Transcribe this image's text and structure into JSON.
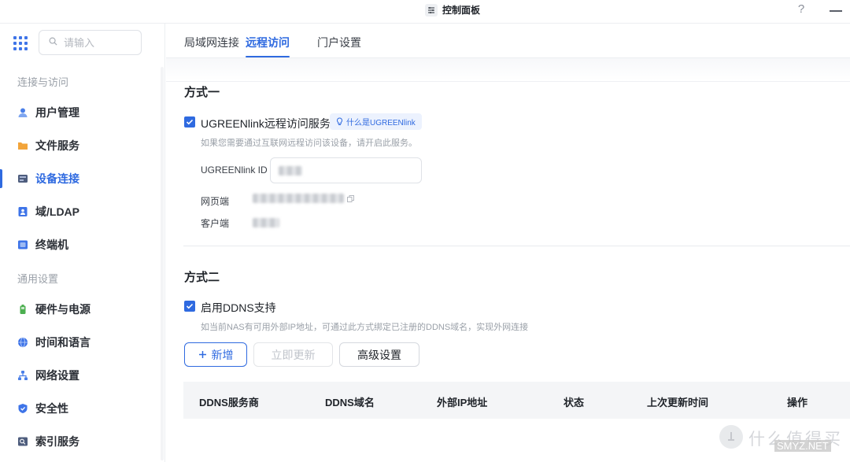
{
  "window": {
    "title": "控制面板",
    "help": "?",
    "app_icon": "sliders-icon"
  },
  "sidebar": {
    "search_placeholder": "请输入",
    "groups": [
      {
        "label": "连接与访问"
      },
      {
        "label": "通用设置"
      }
    ],
    "items": [
      {
        "label": "用户管理",
        "icon": "user-icon",
        "color": "#4a7fe8"
      },
      {
        "label": "文件服务",
        "icon": "folder-icon",
        "color": "#f2a43a"
      },
      {
        "label": "设备连接",
        "icon": "device-connect-icon",
        "color": "#5a6b8f",
        "active": true
      },
      {
        "label": "域/LDAP",
        "icon": "ldap-icon",
        "color": "#3e74e8"
      },
      {
        "label": "终端机",
        "icon": "terminal-icon",
        "color": "#3e74e8"
      },
      {
        "label": "硬件与电源",
        "icon": "battery-icon",
        "color": "#4caf50"
      },
      {
        "label": "时间和语言",
        "icon": "globe-icon",
        "color": "#3e74e8"
      },
      {
        "label": "网络设置",
        "icon": "network-icon",
        "color": "#4a7fe8"
      },
      {
        "label": "安全性",
        "icon": "shield-icon",
        "color": "#3e74e8"
      },
      {
        "label": "索引服务",
        "icon": "index-icon",
        "color": "#5a6b8f"
      }
    ]
  },
  "tabs": [
    {
      "label": "局域网连接"
    },
    {
      "label": "远程访问",
      "active": true
    },
    {
      "label": "门户设置"
    }
  ],
  "method1": {
    "title": "方式一",
    "checkbox_label": "UGREENlink远程访问服务",
    "checked": true,
    "help_link": "什么是UGREENlink",
    "hint": "如果您需要通过互联网远程访问该设备，请开启此服务。",
    "id_label": "UGREENlink ID",
    "web_label": "网页端",
    "client_label": "客户端"
  },
  "method2": {
    "title": "方式二",
    "checkbox_label": "启用DDNS支持",
    "checked": true,
    "hint": "如当前NAS有可用外部IP地址，可通过此方式绑定已注册的DDNS域名，实现外网连接",
    "buttons": {
      "add": "新增",
      "update": "立即更新",
      "advanced": "高级设置"
    }
  },
  "table": {
    "columns": [
      "DDNS服务商",
      "DDNS域名",
      "外部IP地址",
      "状态",
      "上次更新时间",
      "操作"
    ]
  },
  "watermark": {
    "text": "什么值得买",
    "site": "SMYZ.NET"
  },
  "colors": {
    "accent": "#2f6ae0",
    "text": "#1f2329",
    "muted": "#9aa0a8"
  }
}
